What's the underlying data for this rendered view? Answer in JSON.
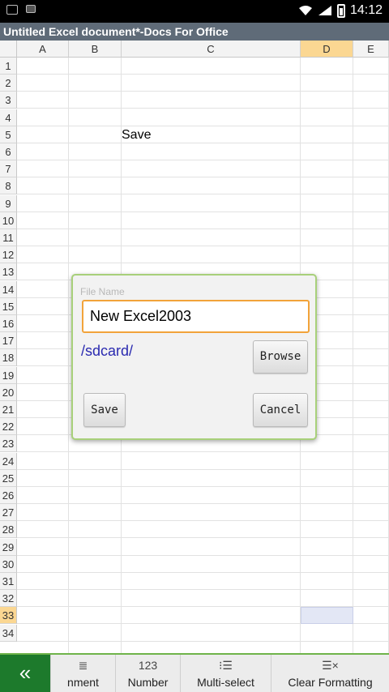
{
  "status_bar": {
    "time": "14:12",
    "icons": [
      "image-icon",
      "keyboard-icon",
      "wifi-icon",
      "signal-icon",
      "battery-icon"
    ]
  },
  "app": {
    "title": "Untitled Excel document*-Docs For Office"
  },
  "sheet": {
    "columns": [
      "A",
      "B",
      "C",
      "D",
      "E"
    ],
    "selected_column": "D",
    "rows": [
      "1",
      "2",
      "3",
      "4",
      "5",
      "6",
      "7",
      "8",
      "9",
      "10",
      "11",
      "12",
      "13",
      "14",
      "15",
      "16",
      "17",
      "18",
      "19",
      "20",
      "21",
      "22",
      "23",
      "24",
      "25",
      "26",
      "27",
      "28",
      "29",
      "30",
      "31",
      "32",
      "33",
      "34"
    ],
    "selected_row": "33",
    "cells": {
      "C5": "Save"
    },
    "selected_cell": "D33",
    "colors": {
      "header_bg": "#f3f3f3",
      "selected_header_bg": "#fbd792",
      "selected_cell_bg": "#e3e7f5"
    }
  },
  "save_dialog": {
    "file_name_label": "File Name",
    "file_name_value": "New Excel2003",
    "path": "/sdcard/",
    "browse_label": "Browse",
    "save_label": "Save",
    "cancel_label": "Cancel",
    "accent_border": "#a8d07a",
    "input_focus_border": "#f2a33a"
  },
  "toolbar": {
    "collapse_icon": "«",
    "items": [
      {
        "label": "nment",
        "icon": "alignment-icon",
        "glyph": "≣"
      },
      {
        "label": "Number",
        "icon": "number-icon",
        "glyph": "123"
      },
      {
        "label": "Multi-select",
        "icon": "multi-select-icon",
        "glyph": "⁝☰"
      },
      {
        "label": "Clear Formatting",
        "icon": "clear-formatting-icon",
        "glyph": "☰×"
      }
    ],
    "accent": "#1d7a2c"
  }
}
